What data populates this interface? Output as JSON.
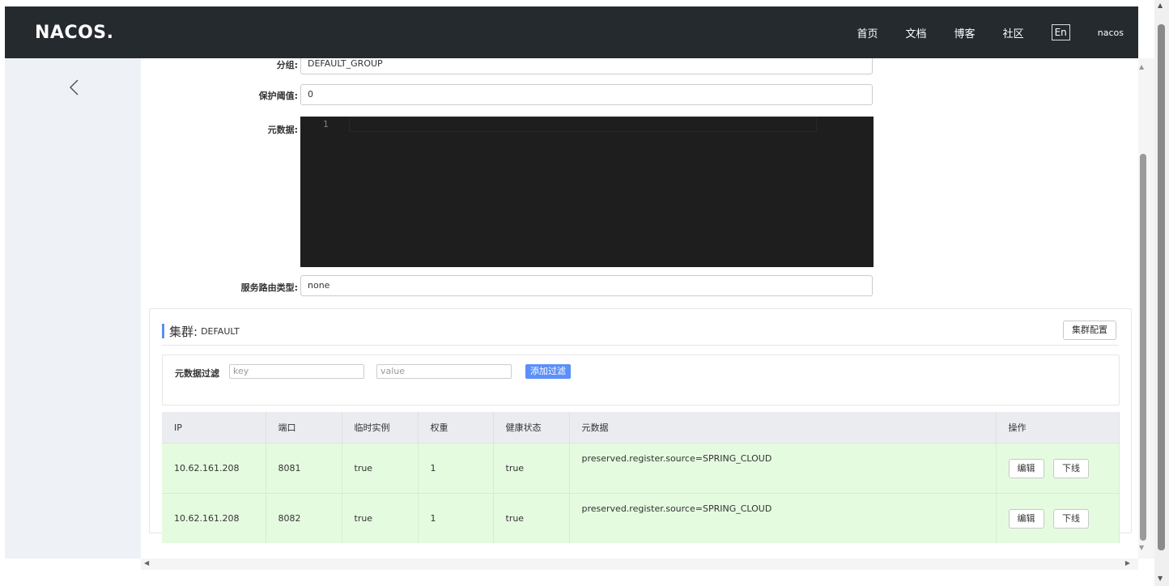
{
  "header": {
    "logo": "NACOS.",
    "nav": [
      "首页",
      "文档",
      "博客",
      "社区"
    ],
    "lang": "En",
    "user": "nacos"
  },
  "form": {
    "group_label": "分组:",
    "group_value": "DEFAULT_GROUP",
    "threshold_label": "保护阈值:",
    "threshold_value": "0",
    "metadata_label": "元数据:",
    "editor_line": "1",
    "route_label": "服务路由类型:",
    "route_value": "none"
  },
  "cluster": {
    "title": "集群:",
    "name": "DEFAULT",
    "config_button": "集群配置",
    "filter_label": "元数据过滤",
    "key_placeholder": "key",
    "value_placeholder": "value",
    "add_filter_button": "添加过滤"
  },
  "table": {
    "headers": [
      "IP",
      "端口",
      "临时实例",
      "权重",
      "健康状态",
      "元数据",
      "操作"
    ],
    "rows": [
      {
        "ip": "10.62.161.208",
        "port": "8081",
        "ephemeral": "true",
        "weight": "1",
        "healthy": "true",
        "metadata": "preserved.register.source=SPRING_CLOUD"
      },
      {
        "ip": "10.62.161.208",
        "port": "8082",
        "ephemeral": "true",
        "weight": "1",
        "healthy": "true",
        "metadata": "preserved.register.source=SPRING_CLOUD"
      }
    ],
    "edit_label": "编辑",
    "offline_label": "下线"
  },
  "colors": {
    "topbar": "#252a2f",
    "sidebar": "#eef1f6",
    "accent": "#5b8ff9",
    "row_healthy": "#e5fbe0",
    "editor_bg": "#1e1e1e"
  }
}
